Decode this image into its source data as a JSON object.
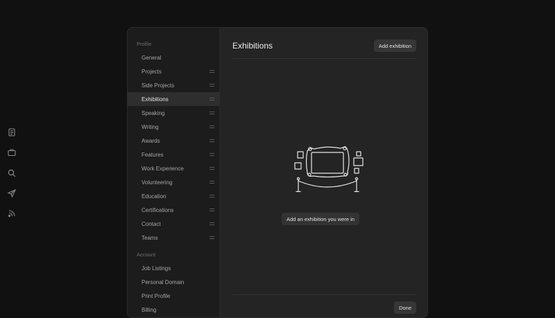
{
  "rail": {
    "icons": [
      "notes-icon",
      "briefcase-icon",
      "search-icon",
      "send-icon",
      "rss-icon"
    ]
  },
  "sidebar": {
    "profile_title": "Profile",
    "profile_items": [
      {
        "label": "General",
        "draggable": false
      },
      {
        "label": "Projects",
        "draggable": true
      },
      {
        "label": "Side Projects",
        "draggable": true
      },
      {
        "label": "Exhibitions",
        "draggable": true,
        "active": true
      },
      {
        "label": "Speaking",
        "draggable": true
      },
      {
        "label": "Writing",
        "draggable": true
      },
      {
        "label": "Awards",
        "draggable": true
      },
      {
        "label": "Features",
        "draggable": true
      },
      {
        "label": "Work Experience",
        "draggable": true
      },
      {
        "label": "Volunteering",
        "draggable": true
      },
      {
        "label": "Education",
        "draggable": true
      },
      {
        "label": "Certifications",
        "draggable": true
      },
      {
        "label": "Contact",
        "draggable": true
      },
      {
        "label": "Teams",
        "draggable": true
      }
    ],
    "account_title": "Account",
    "account_items": [
      {
        "label": "Job Listings"
      },
      {
        "label": "Personal Domain"
      },
      {
        "label": "Print Profile"
      },
      {
        "label": "Billing"
      }
    ]
  },
  "main": {
    "title": "Exhibitions",
    "add_button": "Add exhibition",
    "empty_button": "Add an exhibition you were in",
    "done_button": "Done"
  },
  "colors": {
    "background": "#111111",
    "modal": "#242424",
    "sidebar": "#1c1c1c",
    "active_item": "#2e2e2e",
    "button": "#363636"
  }
}
